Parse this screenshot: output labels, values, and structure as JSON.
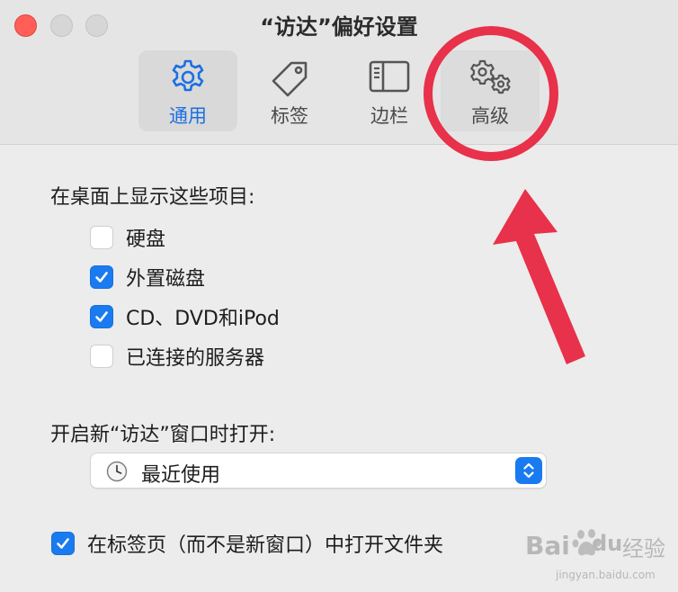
{
  "window": {
    "title": "“访达”偏好设置"
  },
  "toolbar": {
    "tabs": [
      {
        "label": "通用",
        "icon": "gear-icon"
      },
      {
        "label": "标签",
        "icon": "tag-icon"
      },
      {
        "label": "边栏",
        "icon": "sidebar-icon"
      },
      {
        "label": "高级",
        "icon": "gears-icon"
      }
    ],
    "selected_color": "#1a6fe3"
  },
  "desktop": {
    "heading": "在桌面上显示这些项目:",
    "items": [
      {
        "label": "硬盘",
        "checked": false
      },
      {
        "label": "外置磁盘",
        "checked": true
      },
      {
        "label": "CD、DVD和iPod",
        "checked": true
      },
      {
        "label": "已连接的服务器",
        "checked": false
      }
    ]
  },
  "new_window": {
    "heading": "开启新“访达”窗口时打开:",
    "selected": "最近使用",
    "icon": "clock-icon"
  },
  "tabs_option": {
    "label": "在标签页（而不是新窗口）中打开文件夹",
    "checked": true
  },
  "watermark": {
    "brand": "Bai",
    "brand2": "du",
    "service": "经验",
    "site": "jingyan.baidu.com"
  },
  "colors": {
    "accent": "#1a7bf0",
    "annotation": "#e8314a"
  }
}
